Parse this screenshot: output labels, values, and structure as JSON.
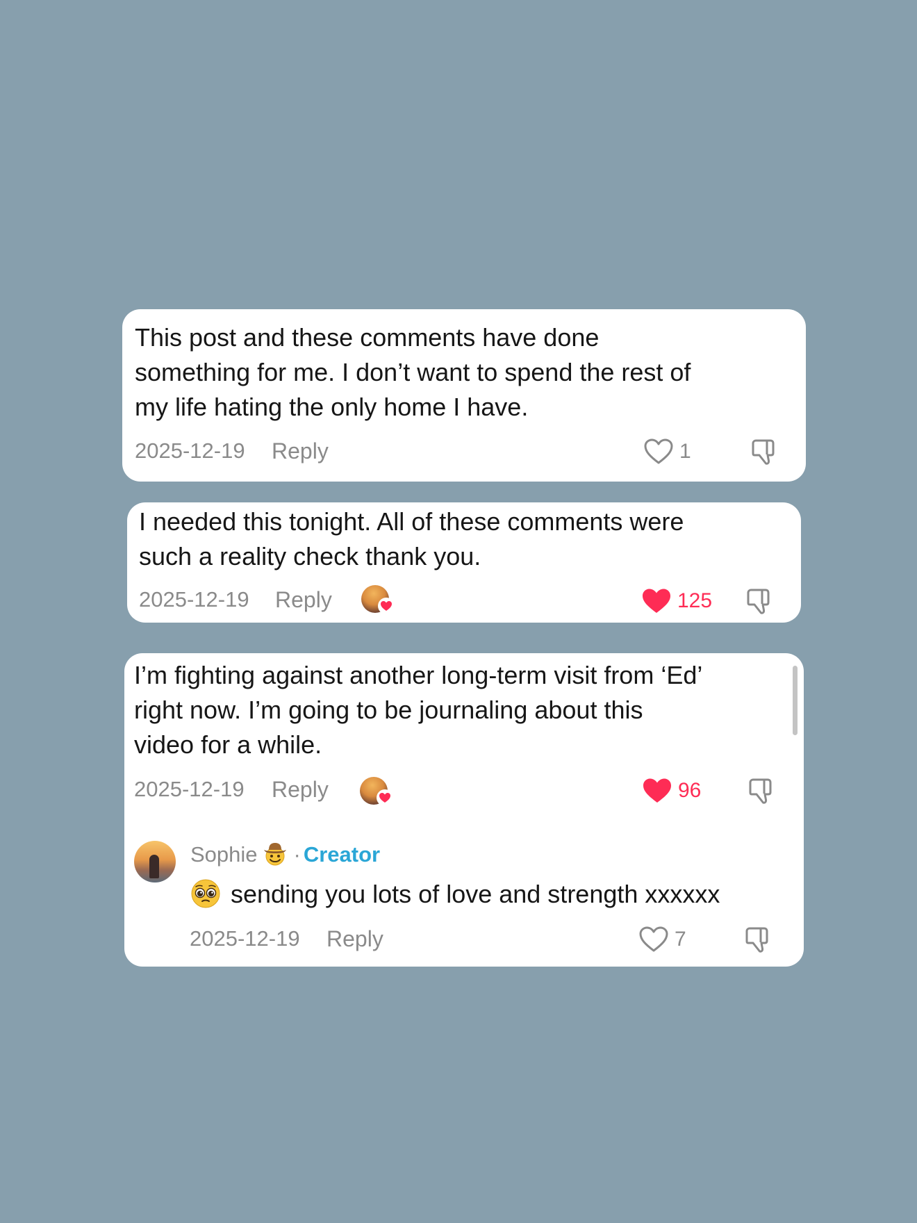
{
  "comments": [
    {
      "text": "This post and these comments have done\nsomething for me. I don’t want to spend the rest of\nmy life hating the only home I have.",
      "date": "2025-12-19",
      "reply_label": "Reply",
      "likes": "1",
      "liked": false,
      "creator_liked": false
    },
    {
      "text": "I needed this tonight. All of these comments were\nsuch a reality check thank you.",
      "date": "2025-12-19",
      "reply_label": "Reply",
      "likes": "125",
      "liked": true,
      "creator_liked": true
    },
    {
      "text": "I’m fighting against another long-term visit from ‘Ed’\nright now. I’m going to be journaling about this\nvideo for a while.",
      "date": "2025-12-19",
      "reply_label": "Reply",
      "likes": "96",
      "liked": true,
      "creator_liked": true,
      "reply": {
        "author": "Sophie",
        "author_emoji": "cowboy-hat-face-icon",
        "separator": "·",
        "badge": "Creator",
        "emoji": "pleading-face-icon",
        "text": "sending you lots of love and strength xxxxxx",
        "date": "2025-12-19",
        "reply_label": "Reply",
        "likes": "7",
        "liked": false
      }
    }
  ],
  "colors": {
    "background": "#879fad",
    "like_red": "#fe2c55",
    "creator_blue": "#2aa6d6",
    "meta_gray": "#8a8a8a"
  }
}
